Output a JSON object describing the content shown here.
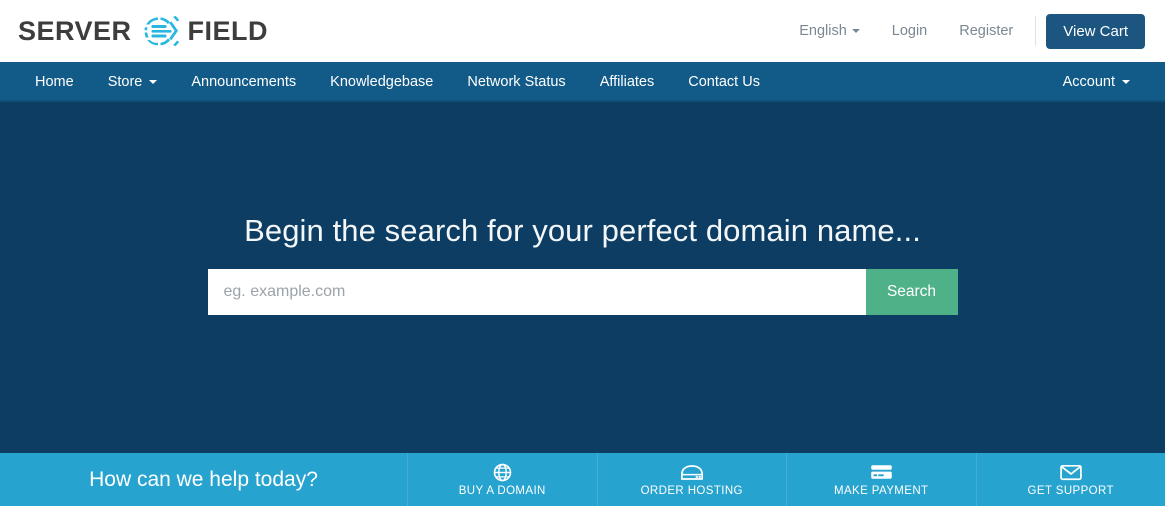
{
  "brand": {
    "name_part1": "SERVER",
    "name_part2": "FIELD",
    "logo_icon": "globe-swoosh-icon",
    "accent_color": "#29b7e0",
    "text_color": "#3d3d3d"
  },
  "header": {
    "language": "English",
    "language_caret": "caret-down-icon",
    "login": "Login",
    "register": "Register",
    "cart_button": "View Cart",
    "cart_button_color": "#1b5580"
  },
  "nav": {
    "background": "#125a87",
    "left_items": [
      {
        "label": "Home",
        "has_caret": false
      },
      {
        "label": "Store",
        "has_caret": true
      },
      {
        "label": "Announcements",
        "has_caret": false
      },
      {
        "label": "Knowledgebase",
        "has_caret": false
      },
      {
        "label": "Network Status",
        "has_caret": false
      },
      {
        "label": "Affiliates",
        "has_caret": false
      },
      {
        "label": "Contact Us",
        "has_caret": false
      }
    ],
    "right_items": [
      {
        "label": "Account",
        "has_caret": true
      }
    ]
  },
  "hero": {
    "background": "#0d3d62",
    "title": "Begin the search for your perfect domain name...",
    "search_placeholder": "eg. example.com",
    "search_value": "",
    "search_button": "Search",
    "search_button_color": "#4fb187"
  },
  "action_bar": {
    "background": "#26a3cf",
    "help_text": "How can we help today?",
    "items": [
      {
        "label": "BUY A DOMAIN",
        "icon": "globe-icon"
      },
      {
        "label": "ORDER HOSTING",
        "icon": "hard-drive-icon"
      },
      {
        "label": "MAKE PAYMENT",
        "icon": "credit-card-icon"
      },
      {
        "label": "GET SUPPORT",
        "icon": "envelope-icon"
      }
    ]
  }
}
